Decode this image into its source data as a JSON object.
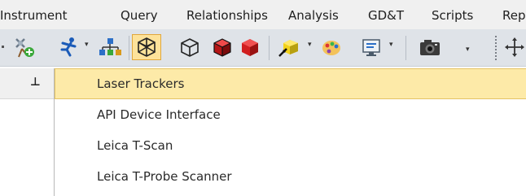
{
  "menubar": {
    "items": [
      "Instrument",
      "Query",
      "Relationships",
      "Analysis",
      "GD&T",
      "Scripts",
      "Rep"
    ]
  },
  "toolbar": {
    "buttons": [
      {
        "icon": "add-point-icon"
      },
      {
        "icon": "running-man-icon",
        "has_dropdown": true
      },
      {
        "icon": "network-hierarchy-icon"
      },
      {
        "icon": "wireframe-cube-icon",
        "active": true
      },
      {
        "icon": "outline-cube-icon"
      },
      {
        "icon": "shaded-cube-icon"
      },
      {
        "icon": "red-solid-icon"
      },
      {
        "icon": "yellow-cube-icon",
        "has_dropdown": true
      },
      {
        "icon": "color-palette-icon"
      },
      {
        "icon": "display-settings-icon",
        "has_dropdown": true
      },
      {
        "icon": "camera-icon"
      },
      {
        "icon": "move-handle-icon"
      }
    ],
    "dropdown_glyph": "▾"
  },
  "panel": {
    "pin_glyph": "⊥"
  },
  "dropdown_menu": {
    "items": [
      {
        "label": "Laser Trackers",
        "highlighted": true
      },
      {
        "label": "API Device Interface",
        "highlighted": false
      },
      {
        "label": "Leica T-Scan",
        "highlighted": false
      },
      {
        "label": "Leica T-Probe Scanner",
        "highlighted": false
      }
    ]
  },
  "colors": {
    "menubar_bg": "#f0f0f0",
    "toolbar_bg": "#dfe3e8",
    "highlight_bg": "#fdeaa8",
    "highlight_border": "#e5c365",
    "shaded_cube": "#d11f1f",
    "accent_yellow": "#f2d21b"
  }
}
